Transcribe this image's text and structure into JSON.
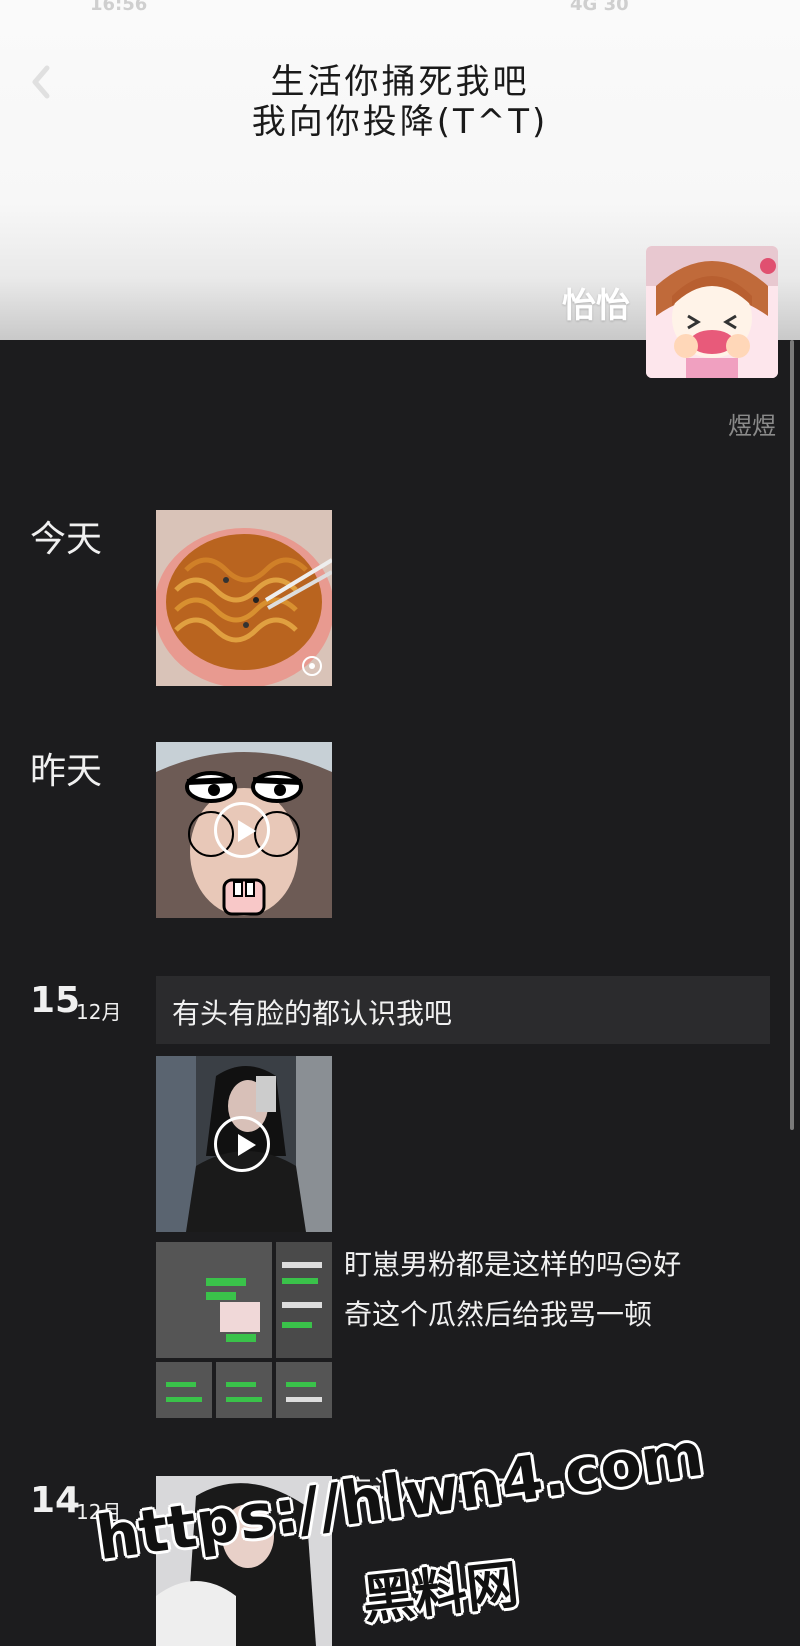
{
  "status_bar": {
    "time": "16:56",
    "right": "4G 30"
  },
  "nav": {
    "back_icon": "chevron-left-icon"
  },
  "cover": {
    "line1": "生活你捅死我吧",
    "line2": "我向你投降(T^T)"
  },
  "profile": {
    "name": "怡怡",
    "signature": "煜煜"
  },
  "timeline": {
    "today_label": "今天",
    "yesterday_label": "昨天",
    "day15": "15",
    "month15": "12月",
    "day14": "14",
    "month14": "12月",
    "text_post": "有头有脸的都认识我吧",
    "post_line1": "盯崽男粉都是这样的吗😒好",
    "post_line2": "奇这个瓜然后给我骂一顿",
    "post14_text": "忘记加一张了"
  },
  "watermark": {
    "line1": "https://hlwn4.com",
    "line2": "黑料网"
  },
  "colors": {
    "background": "#1c1c1e",
    "card": "#2b2b2d",
    "text": "#f0f0f0",
    "muted": "#8a8a8a"
  }
}
